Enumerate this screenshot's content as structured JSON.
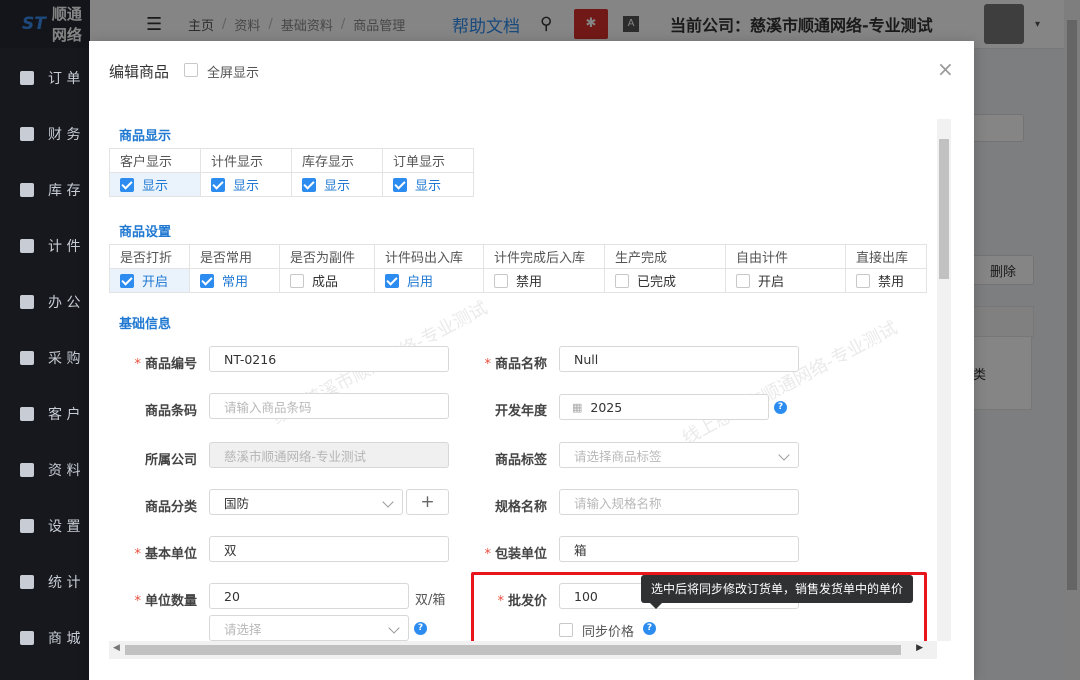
{
  "app": {
    "logo_text": "顺通网络",
    "sidebar": [
      "订 单",
      "财 务",
      "库 存",
      "计 件",
      "办 公",
      "采 购",
      "客 户",
      "资 料",
      "设 置",
      "统 计",
      "商 城"
    ],
    "breadcrumb": [
      "主页",
      "资料",
      "基础资料",
      "商品管理"
    ],
    "help_link": "帮助文档",
    "company_label": "当前公司：慈溪市顺通网络-专业测试",
    "delete_label": "删除",
    "bg_fragment": "类"
  },
  "modal": {
    "title": "编辑商品",
    "fullscreen_label": "全屏显示",
    "watermark": "线上慈溪市顺通网络-专业测试"
  },
  "display_section": {
    "title": "商品显示",
    "headers": [
      "客户显示",
      "计件显示",
      "库存显示",
      "订单显示"
    ],
    "values": [
      {
        "label": "显示",
        "checked": true
      },
      {
        "label": "显示",
        "checked": true
      },
      {
        "label": "显示",
        "checked": true
      },
      {
        "label": "显示",
        "checked": true
      }
    ]
  },
  "settings_section": {
    "title": "商品设置",
    "headers": [
      "是否打折",
      "是否常用",
      "是否为副件",
      "计件码出入库",
      "计件完成后入库",
      "生产完成",
      "自由计件",
      "直接出库"
    ],
    "values": [
      {
        "label": "开启",
        "checked": true
      },
      {
        "label": "常用",
        "checked": true
      },
      {
        "label": "成品",
        "checked": false
      },
      {
        "label": "启用",
        "checked": true
      },
      {
        "label": "禁用",
        "checked": false
      },
      {
        "label": "已完成",
        "checked": false
      },
      {
        "label": "开启",
        "checked": false
      },
      {
        "label": "禁用",
        "checked": false
      }
    ]
  },
  "basic_section": {
    "title": "基础信息",
    "code_label": "商品编号",
    "code_value": "NT-0216",
    "name_label": "商品名称",
    "name_value": "Null",
    "barcode_label": "商品条码",
    "barcode_placeholder": "请输入商品条码",
    "year_label": "开发年度",
    "year_value": "2025",
    "company_label": "所属公司",
    "company_value": "慈溪市顺通网络-专业测试",
    "tag_label": "商品标签",
    "tag_placeholder": "请选择商品标签",
    "category_label": "商品分类",
    "category_value": "国防",
    "add_symbol": "+",
    "spec_label": "规格名称",
    "spec_placeholder": "请输入规格名称",
    "base_unit_label": "基本单位",
    "base_unit_value": "双",
    "pack_unit_label": "包装单位",
    "pack_unit_value": "箱",
    "unit_qty_label": "单位数量",
    "unit_qty_value": "20",
    "unit_qty_suffix": "双/箱",
    "select_placeholder": "请选择",
    "wholesale_label": "批发价",
    "wholesale_value": "100",
    "sync_label": "同步价格",
    "tooltip": "选中后将同步修改订货单，销售发货单中的单价"
  },
  "colors": {
    "accent": "#2d8cf0",
    "required": "#e74c3c",
    "highlight_border": "#e8151b"
  }
}
